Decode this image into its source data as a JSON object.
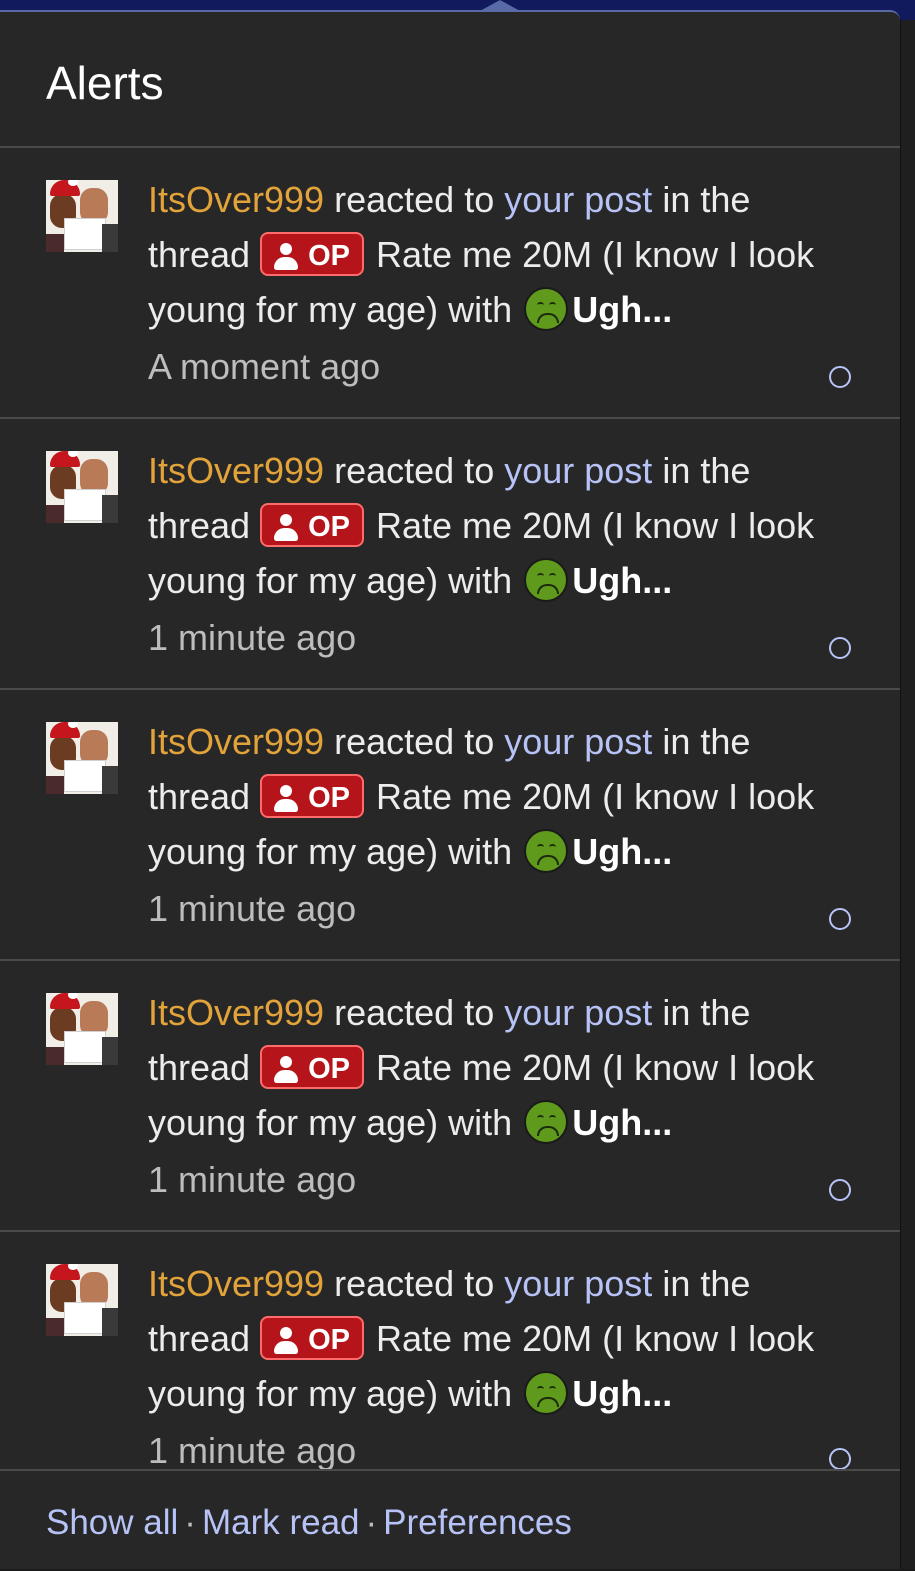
{
  "panel": {
    "title": "Alerts"
  },
  "alerts": [
    {
      "user": "ItsOver999",
      "text_reacted": "reacted to",
      "link": "your post",
      "text_thread": "in the thread",
      "badge": "OP",
      "thread_title": "Rate me 20M (I know I look young for my age)",
      "text_with": "with",
      "reaction": "Ugh...",
      "time": "A moment ago"
    },
    {
      "user": "ItsOver999",
      "text_reacted": "reacted to",
      "link": "your post",
      "text_thread": "in the thread",
      "badge": "OP",
      "thread_title": "Rate me 20M (I know I look young for my age)",
      "text_with": "with",
      "reaction": "Ugh...",
      "time": "1 minute ago"
    },
    {
      "user": "ItsOver999",
      "text_reacted": "reacted to",
      "link": "your post",
      "text_thread": "in the thread",
      "badge": "OP",
      "thread_title": "Rate me 20M (I know I look young for my age)",
      "text_with": "with",
      "reaction": "Ugh...",
      "time": "1 minute ago"
    },
    {
      "user": "ItsOver999",
      "text_reacted": "reacted to",
      "link": "your post",
      "text_thread": "in the thread",
      "badge": "OP",
      "thread_title": "Rate me 20M (I know I look young for my age)",
      "text_with": "with",
      "reaction": "Ugh...",
      "time": "1 minute ago"
    },
    {
      "user": "ItsOver999",
      "text_reacted": "reacted to",
      "link": "your post",
      "text_thread": "in the thread",
      "badge": "OP",
      "thread_title": "Rate me 20M (I know I look young for my age)",
      "text_with": "with",
      "reaction": "Ugh...",
      "time": "1 minute ago"
    }
  ],
  "footer": {
    "show_all": "Show all",
    "mark_read": "Mark read",
    "preferences": "Preferences",
    "separator": "·"
  },
  "icons": {
    "op_badge": "user-icon",
    "reaction": "nauseated-face-icon",
    "unread": "unread-circle-icon"
  },
  "colors": {
    "background": "#272727",
    "username": "#e1a33a",
    "link": "#b7c3f7",
    "op_badge": "#b5141b",
    "reaction_emoji": "#5f9a1c"
  }
}
